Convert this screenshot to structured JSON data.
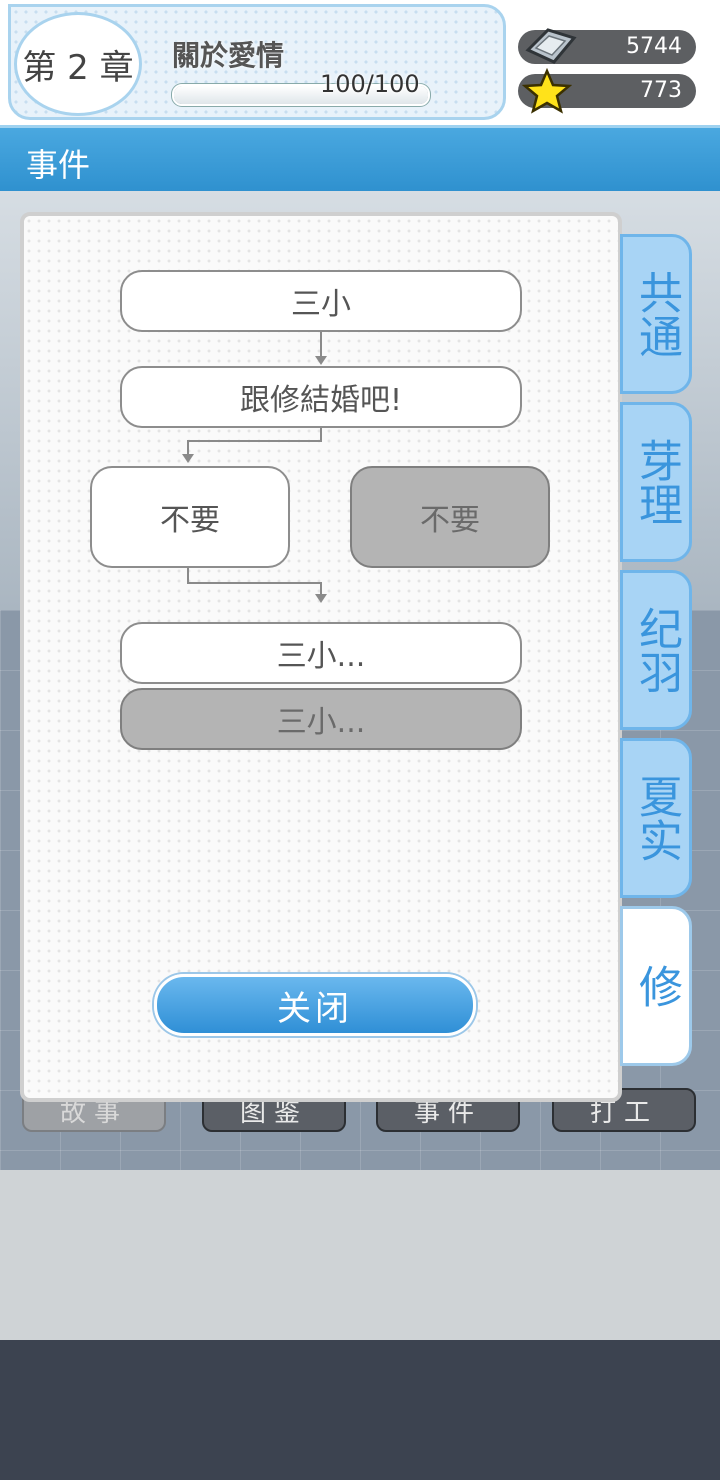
{
  "header": {
    "chapter_label": "第 2 章",
    "chapter_title": "關於愛情",
    "progress_text": "100/100",
    "progress_fraction": 1.0,
    "gems": "5744",
    "stars": "773"
  },
  "section": {
    "title": "事件"
  },
  "flow": {
    "node1": "三小",
    "node2": "跟修結婚吧!",
    "choice_a": "不要",
    "choice_b": "不要",
    "result1": "三小...",
    "result2": "三小..."
  },
  "modal": {
    "close_label": "关闭"
  },
  "side_tabs": [
    {
      "label": "共通"
    },
    {
      "label": "芽理"
    },
    {
      "label": "纪羽"
    },
    {
      "label": "夏实"
    },
    {
      "label": "修"
    }
  ],
  "bottom_tabs": [
    {
      "label": "故事"
    },
    {
      "label": "图鉴"
    },
    {
      "label": "事件"
    },
    {
      "label": "打工"
    }
  ],
  "colors": {
    "accent_blue": "#2f91cf",
    "tab_blue": "#a8d4f5",
    "node_gray": "#b4b4b4"
  }
}
